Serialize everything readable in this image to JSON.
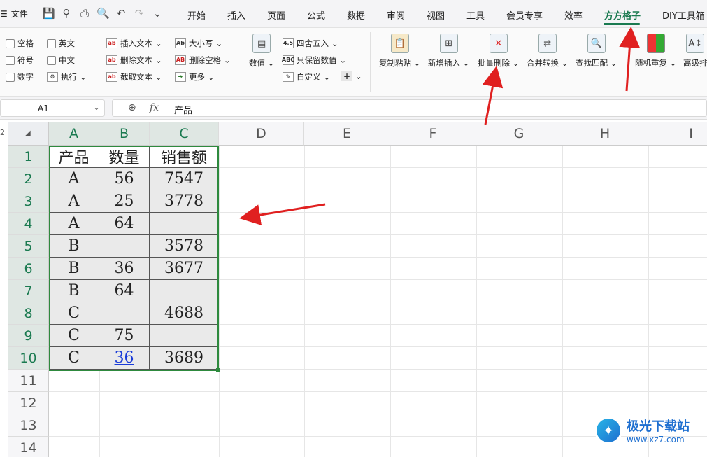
{
  "menu": {
    "file_label": "文件",
    "quick_access": [
      "💾",
      "⚲",
      "⎙",
      "🔍",
      "↶",
      "↷",
      "⌄"
    ],
    "tabs": [
      "开始",
      "插入",
      "页面",
      "公式",
      "数据",
      "审阅",
      "视图",
      "工具",
      "会员专享",
      "效率",
      "方方格子",
      "DIY工具箱"
    ],
    "active_tab": "方方格子"
  },
  "ribbon": {
    "checkboxes": [
      "空格",
      "英文",
      "符号",
      "中文",
      "数字"
    ],
    "execute_label": "执行",
    "text_tools": [
      "插入文本",
      "删除文本",
      "截取文本"
    ],
    "case_tools": [
      "大小写",
      "删除空格",
      "更多"
    ],
    "numeric_label": "数值",
    "round_tools": [
      "四舍五入",
      "只保留数值",
      "自定义"
    ],
    "plus_label": "+",
    "big_buttons": [
      "复制粘贴",
      "新增插入",
      "批量删除",
      "合并转换",
      "查找匹配",
      "随机重复",
      "高级排"
    ]
  },
  "formula_bar": {
    "name_box": "A1",
    "fx_label": "fx",
    "content": "产品"
  },
  "grid": {
    "top_left_label": "2",
    "columns": [
      "A",
      "B",
      "C",
      "D",
      "E",
      "F",
      "G",
      "H",
      "I"
    ],
    "rows": [
      "1",
      "2",
      "3",
      "4",
      "5",
      "6",
      "7",
      "8",
      "9",
      "10",
      "11",
      "12",
      "13",
      "14"
    ],
    "table": [
      [
        "产品",
        "数量",
        "销售额"
      ],
      [
        "A",
        "56",
        "7547"
      ],
      [
        "A",
        "25",
        "3778"
      ],
      [
        "A",
        "64",
        ""
      ],
      [
        "B",
        "",
        "3578"
      ],
      [
        "B",
        "36",
        "3677"
      ],
      [
        "B",
        "64",
        ""
      ],
      [
        "C",
        "",
        "4688"
      ],
      [
        "C",
        "75",
        ""
      ],
      [
        "C",
        "36",
        "3689"
      ]
    ]
  },
  "watermark": {
    "name": "极光下载站",
    "url": "www.xz7.com"
  },
  "colors": {
    "accent": "#1a7a50",
    "selection": "#2e8a3e",
    "arrow": "#e02020"
  }
}
